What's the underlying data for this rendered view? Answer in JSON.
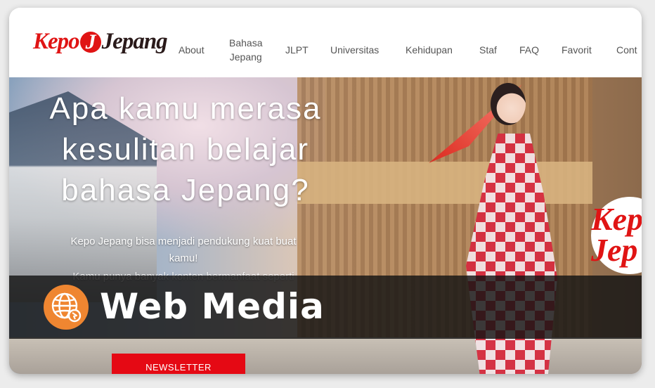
{
  "site": {
    "logo": {
      "part1": "Kepo",
      "part2": "Jepang"
    }
  },
  "nav": {
    "items": [
      {
        "label": "About"
      },
      {
        "label": "Bahasa",
        "label2": "Jepang"
      },
      {
        "label": "JLPT"
      },
      {
        "label": "Universitas"
      },
      {
        "label": "Kehidupan"
      },
      {
        "label": "Staf"
      },
      {
        "label": "FAQ"
      },
      {
        "label": "Favorit"
      },
      {
        "label": "Cont"
      }
    ]
  },
  "hero": {
    "headline_line1": "Apa kamu merasa",
    "headline_line2": "kesulitan belajar",
    "headline_line3": "bahasa Jepang?",
    "subtext_line1": "Kepo Jepang bisa menjadi pendukung kuat buat",
    "subtext_line2": "kamu!",
    "subtext_line3": "Kamu punya banyak konten bermanfaat seperti",
    "newsletter_button": "NEWSLETTER",
    "badge_line1": "Kep",
    "badge_line2": "Jep"
  },
  "overlay": {
    "icon": "globe-icon",
    "label": "Web Media",
    "accent_color": "#ef8631"
  }
}
